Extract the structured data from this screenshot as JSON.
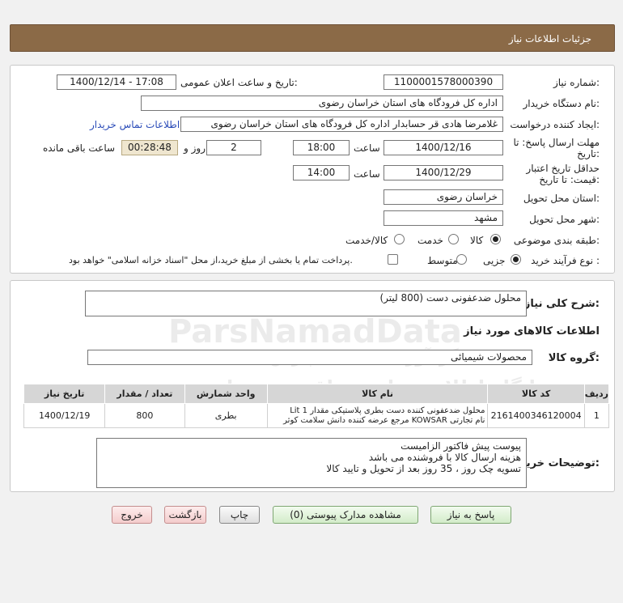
{
  "header": {
    "title": "جزئیات اطلاعات نیاز"
  },
  "form": {
    "need_number_label": "شماره نیاز:",
    "need_number": "1100001578000390",
    "announce_label": "تاریخ و ساعت اعلان عمومی:",
    "announce_value": "1400/12/14 - 17:08",
    "buyer_label": "نام دستگاه خریدار:",
    "buyer_value": "اداره کل فرودگاه های استان خراسان رضوی",
    "creator_label": "ایجاد کننده درخواست:",
    "creator_value": "غلامرضا هادی قر حسابدار اداره کل فرودگاه های استان خراسان رضوی",
    "contact_link": "اطلاعات تماس خریدار",
    "deadline_label_1": "مهلت ارسال پاسخ: تا",
    "deadline_label_2": "تاریخ:",
    "deadline_date": "1400/12/16",
    "time_label": "ساعت",
    "deadline_time": "18:00",
    "days_value": "2",
    "days_label": "روز و",
    "remaining_value": "00:28:48",
    "remaining_label": "ساعت باقی مانده",
    "validity_label_1": "حداقل تاریخ اعتبار",
    "validity_label_2": "قیمت: تا تاریخ:",
    "validity_date": "1400/12/29",
    "validity_time": "14:00",
    "province_label": "استان محل تحویل:",
    "province_value": "خراسان رضوی",
    "city_label": "شهر محل تحویل:",
    "city_value": "مشهد",
    "category_label": "طبقه بندی موضوعی:",
    "category_options": [
      "کالا",
      "خدمت",
      "کالا/خدمت"
    ],
    "process_label": "نوع فرآیند خرید :",
    "process_options": [
      "جزیی",
      "متوسط"
    ],
    "payment_note": "پرداخت تمام یا بخشی از مبلغ خرید،از محل \"اسناد خزانه اسلامی\" خواهد بود."
  },
  "details": {
    "summary_label": "شرح کلی نیاز:",
    "summary_value": "محلول ضدعفونی دست (800 لیتر)",
    "goods_info_title": "اطلاعات کالاهای مورد نیاز",
    "group_label": "گروه کالا:",
    "group_value": "محصولات شیمیائی",
    "table": {
      "headers": [
        "ردیف",
        "کد کالا",
        "نام کالا",
        "واحد شمارش",
        "تعداد / مقدار",
        "تاریخ نیاز"
      ],
      "rows": [
        {
          "row": "1",
          "code": "2161400346120004",
          "name_line1": "محلول ضدعفونی کننده دست بطری پلاستیکی مقدار 1 Lit",
          "name_line2": "نام تجارتی KOWSAR مرجع عرضه کننده دانش سلامت کوثر",
          "unit": "بطری",
          "qty": "800",
          "date": "1400/12/19"
        }
      ]
    },
    "buyer_notes_label": "توضیحات خریدار:",
    "buyer_notes": [
      "پیوست پیش فاکتور الزامیست",
      "هزینه ارسال کالا با فروشنده می باشد",
      "تسویه چک روز ، 35 روز بعد از تحویل و تایید کالا"
    ]
  },
  "buttons": {
    "reply": "پاسخ به نیاز",
    "view_docs": "مشاهده مدارک پیوستی (0)",
    "print": "چاپ",
    "back": "بازگشت",
    "exit": "خروج"
  },
  "watermark": {
    "brand": "ParsNamadData",
    "tagline": "پایگاه اطلاع رسانی مناقصه و مزایده",
    "tagline2": "گردآوری اطلاعات پارس نماد داده ها"
  }
}
